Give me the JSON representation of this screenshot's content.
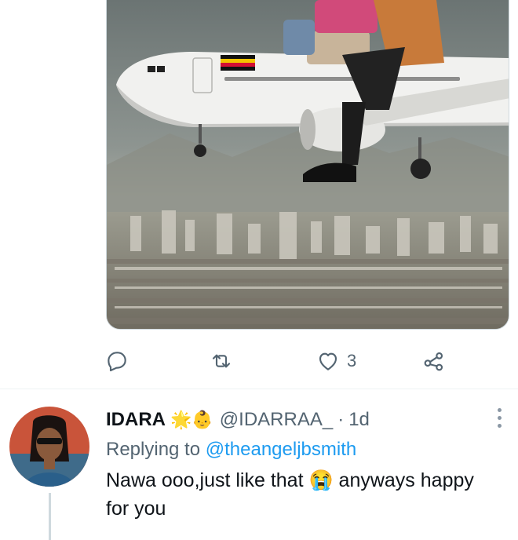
{
  "tweet_actions": {
    "reply_count": "",
    "retweet_count": "",
    "like_count": "3",
    "share_label": ""
  },
  "reply": {
    "display_name": "IDARA",
    "name_emojis": "🌟👶",
    "handle": "@IDARRAA_",
    "separator": "·",
    "time": "1d",
    "replying_prefix": "Replying to ",
    "replying_to": "@theangeljbsmith",
    "text": "Nawa ooo,just like that 😭 anyways happy for you"
  },
  "icons": {
    "reply": "speech-bubble-icon",
    "retweet": "retweet-icon",
    "like": "heart-icon",
    "share": "share-icon",
    "more": "more-dots-icon"
  },
  "colors": {
    "text": "#0f1419",
    "secondary": "#536471",
    "link": "#1d9bf0",
    "border": "#cfd9de"
  }
}
